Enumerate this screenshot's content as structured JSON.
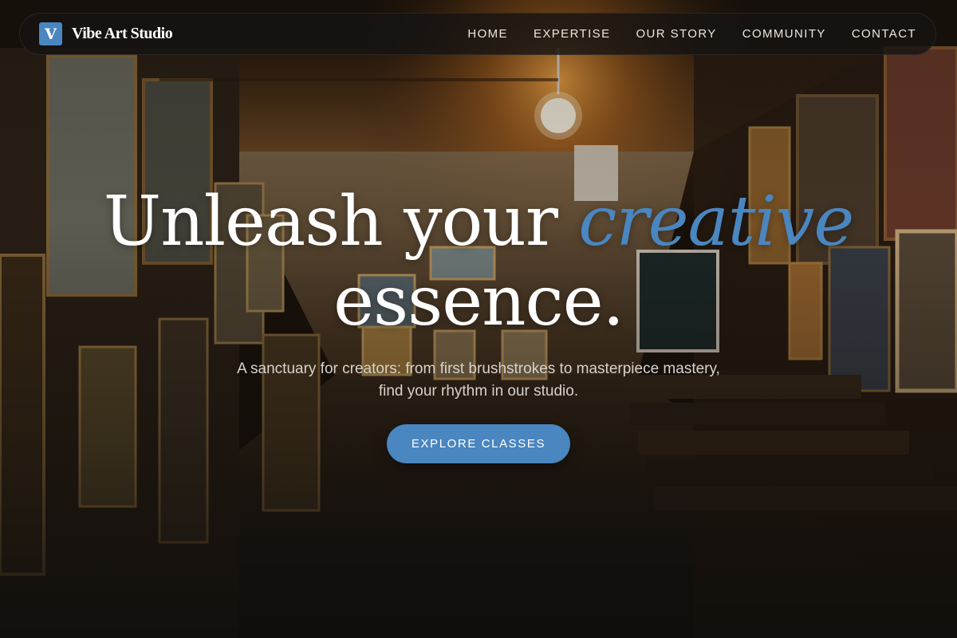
{
  "brand": {
    "logo_letter": "V",
    "name": "Vibe Art Studio"
  },
  "nav": {
    "items": [
      {
        "label": "HOME"
      },
      {
        "label": "EXPERTISE"
      },
      {
        "label": "OUR STORY"
      },
      {
        "label": "COMMUNITY"
      },
      {
        "label": "CONTACT"
      }
    ]
  },
  "hero": {
    "headline_part1": "Unleash your ",
    "headline_accent": "creative",
    "headline_part2": "essence.",
    "subtitle": "A sanctuary for creators: from first brushstrokes to masterpiece mastery, find your rhythm in our studio.",
    "cta_label": "EXPLORE CLASSES",
    "background_image": "art-studio-gallery-photo"
  },
  "colors": {
    "accent": "#4a86c0",
    "nav_bg": "#161412",
    "text": "#ffffff"
  }
}
